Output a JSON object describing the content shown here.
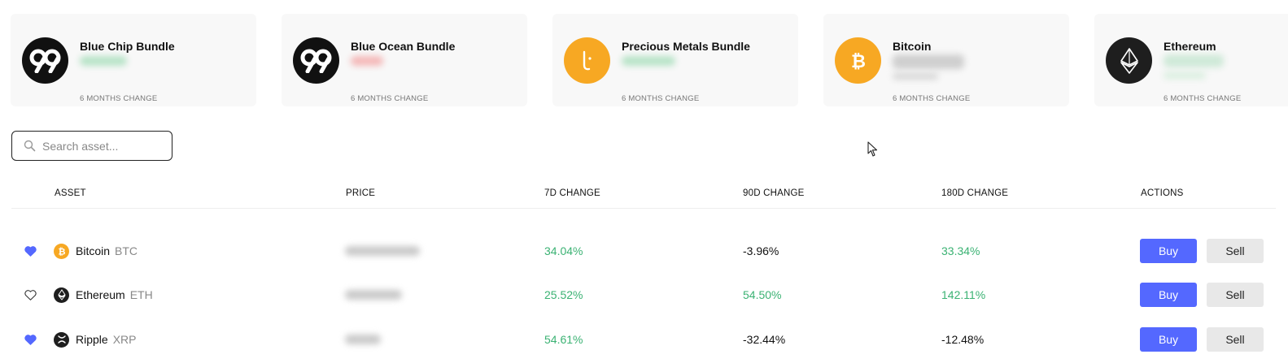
{
  "cards": [
    {
      "name": "Blue Chip Bundle",
      "change_label": "6 MONTHS CHANGE",
      "logo": "ninety-nine-logo-icon",
      "logo_bg": "#111111",
      "trend": "positive"
    },
    {
      "name": "Blue Ocean Bundle",
      "change_label": "6 MONTHS CHANGE",
      "logo": "ninety-nine-logo-icon",
      "logo_bg": "#111111",
      "trend": "negative"
    },
    {
      "name": "Precious Metals Bundle",
      "change_label": "6 MONTHS CHANGE",
      "logo": "precious-metals-logo-icon",
      "logo_bg": "#f7a823",
      "trend": "positive"
    },
    {
      "name": "Bitcoin",
      "change_label": "6 MONTHS CHANGE",
      "logo": "bitcoin-logo-icon",
      "logo_bg": "#f7a823",
      "trend": "neutral"
    },
    {
      "name": "Ethereum",
      "change_label": "6 MONTHS CHANGE",
      "logo": "ethereum-logo-icon",
      "logo_bg": "#1e1e1e",
      "trend": "positive"
    }
  ],
  "search": {
    "placeholder": "Search asset...",
    "value": ""
  },
  "table": {
    "headers": {
      "asset": "ASSET",
      "price": "PRICE",
      "change_7d": "7D CHANGE",
      "change_90d": "90D CHANGE",
      "change_180d": "180D CHANGE",
      "actions": "ACTIONS"
    },
    "rows": [
      {
        "name": "Bitcoin",
        "symbol": "BTC",
        "favorite": true,
        "coin_icon": "bitcoin-icon",
        "change_7d": "34.04%",
        "change_90d": "-3.96%",
        "change_180d": "33.34%",
        "buy": "Buy",
        "sell": "Sell"
      },
      {
        "name": "Ethereum",
        "symbol": "ETH",
        "favorite": false,
        "coin_icon": "ethereum-icon",
        "change_7d": "25.52%",
        "change_90d": "54.50%",
        "change_180d": "142.11%",
        "buy": "Buy",
        "sell": "Sell"
      },
      {
        "name": "Ripple",
        "symbol": "XRP",
        "favorite": true,
        "coin_icon": "ripple-icon",
        "change_7d": "54.61%",
        "change_90d": "-32.44%",
        "change_180d": "-12.48%",
        "buy": "Buy",
        "sell": "Sell"
      }
    ]
  },
  "colors": {
    "positive": "#3bb273",
    "negative": "#111111",
    "accent": "#5468ff",
    "favorite": "#5468ff"
  }
}
